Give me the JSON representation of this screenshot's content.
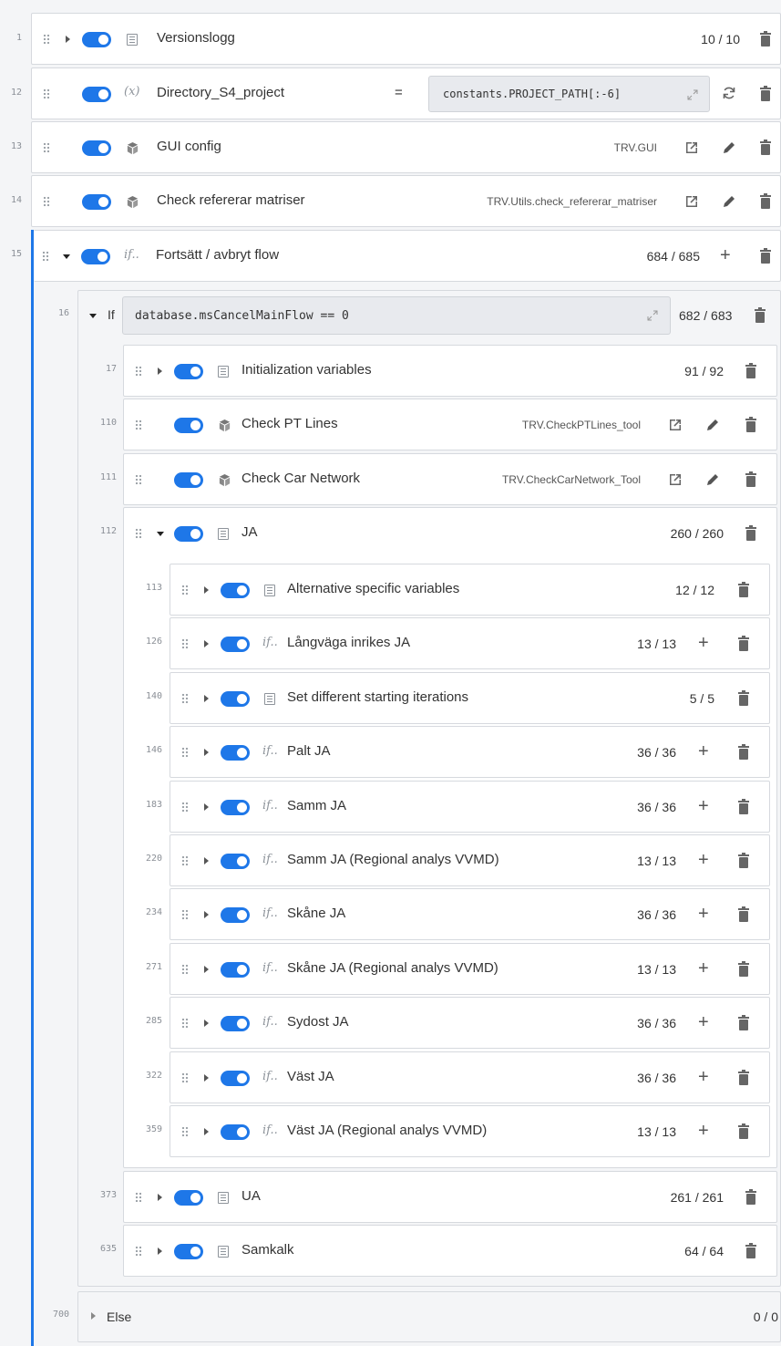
{
  "rows": {
    "versionslogg": {
      "line": "1",
      "label": "Versionslogg",
      "count": "10 / 10"
    },
    "directory": {
      "line": "12",
      "label": "Directory_S4_project",
      "operator": "=",
      "value": "constants.PROJECT_PATH[:-6]"
    },
    "gui_config": {
      "line": "13",
      "label": "GUI config",
      "ref": "TRV.GUI"
    },
    "check_ref": {
      "line": "14",
      "label": "Check refererar matriser",
      "ref": "TRV.Utils.check_refererar_matriser"
    },
    "fortsatt": {
      "line": "15",
      "label": "Fortsätt / avbryt flow",
      "count": "684 / 685"
    },
    "if_block": {
      "line": "16",
      "keyword": "If",
      "condition": "database.msCancelMainFlow == 0",
      "count": "682 / 683"
    },
    "init_vars": {
      "line": "17",
      "label": "Initialization variables",
      "count": "91 / 92"
    },
    "check_pt": {
      "line": "110",
      "label": "Check PT Lines",
      "ref": "TRV.CheckPTLines_tool"
    },
    "check_car": {
      "line": "111",
      "label": "Check Car Network",
      "ref": "TRV.CheckCarNetwork_Tool"
    },
    "ja": {
      "line": "112",
      "label": "JA",
      "count": "260 / 260"
    },
    "ja_children": [
      {
        "line": "113",
        "label": "Alternative specific variables",
        "count": "12 / 12",
        "type": "group"
      },
      {
        "line": "126",
        "label": "Långväga inrikes JA",
        "count": "13 / 13",
        "type": "if"
      },
      {
        "line": "140",
        "label": "Set different starting iterations",
        "count": "5 / 5",
        "type": "group"
      },
      {
        "line": "146",
        "label": "Palt JA",
        "count": "36 / 36",
        "type": "if"
      },
      {
        "line": "183",
        "label": "Samm JA",
        "count": "36 / 36",
        "type": "if"
      },
      {
        "line": "220",
        "label": "Samm JA (Regional analys VVMD)",
        "count": "13 / 13",
        "type": "if"
      },
      {
        "line": "234",
        "label": "Skåne JA",
        "count": "36 / 36",
        "type": "if"
      },
      {
        "line": "271",
        "label": "Skåne JA (Regional analys VVMD)",
        "count": "13 / 13",
        "type": "if"
      },
      {
        "line": "285",
        "label": "Sydost JA",
        "count": "36 / 36",
        "type": "if"
      },
      {
        "line": "322",
        "label": "Väst JA",
        "count": "36 / 36",
        "type": "if"
      },
      {
        "line": "359",
        "label": "Väst JA (Regional analys VVMD)",
        "count": "13 / 13",
        "type": "if"
      }
    ],
    "ua": {
      "line": "373",
      "label": "UA",
      "count": "261 / 261"
    },
    "samkalk": {
      "line": "635",
      "label": "Samkalk",
      "count": "64 / 64"
    },
    "else_block": {
      "line": "700",
      "keyword": "Else",
      "count": "0 / 0"
    }
  },
  "icons": {
    "if_glyph": "if..",
    "var_glyph": "(x)",
    "plus_glyph": "+"
  },
  "colors": {
    "accent": "#1e77e8",
    "background": "#f4f5f7",
    "border": "#d6d9de"
  }
}
